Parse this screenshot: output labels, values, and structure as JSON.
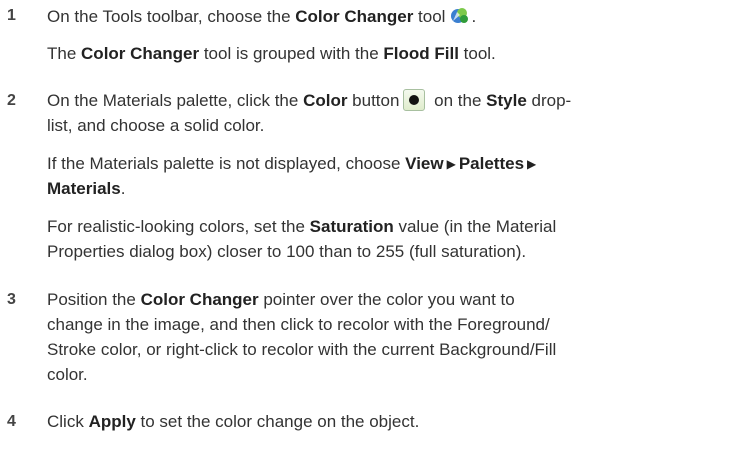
{
  "steps": [
    {
      "num": "1",
      "main_a": "On the Tools toolbar, choose the ",
      "main_b": "Color Changer",
      "main_c": " tool",
      "note_a": "The ",
      "note_b": "Color Changer",
      "note_c": " tool is grouped with the ",
      "note_d": "Flood Fill",
      "note_e": " tool.",
      "icon": "color-changer-icon"
    },
    {
      "num": "2",
      "l1_a": "On the Materials palette, click the ",
      "l1_b": "Color",
      "l1_c": " button",
      "l1_d": " on the ",
      "l1_e": "Style",
      "l1_f": " drop-",
      "l2": "list, and choose a solid color.",
      "n1_a": "If the Materials palette is not displayed, choose ",
      "n1_b": "View",
      "n1_c": "Palettes",
      "n1_d": "Materials",
      "n1_e": ".",
      "n2_a": "For realistic-looking colors, set the ",
      "n2_b": "Saturation",
      "n2_c": " value (in the Material",
      "n2_l2": "Properties dialog box) closer to 100 than to 255 (full saturation).",
      "icon": "color-button-icon"
    },
    {
      "num": "3",
      "l1_a": "Position the ",
      "l1_b": "Color Changer",
      "l1_c": " pointer over the color you want to",
      "l2": "change in the image, and then click to recolor with the Foreground/",
      "l3": "Stroke color, or right-click to recolor with the current Background/Fill",
      "l4": "color."
    },
    {
      "num": "4",
      "l1_a": "Click ",
      "l1_b": "Apply",
      "l1_c": " to set the color change on the object."
    }
  ],
  "arrow_glyph": "▶"
}
